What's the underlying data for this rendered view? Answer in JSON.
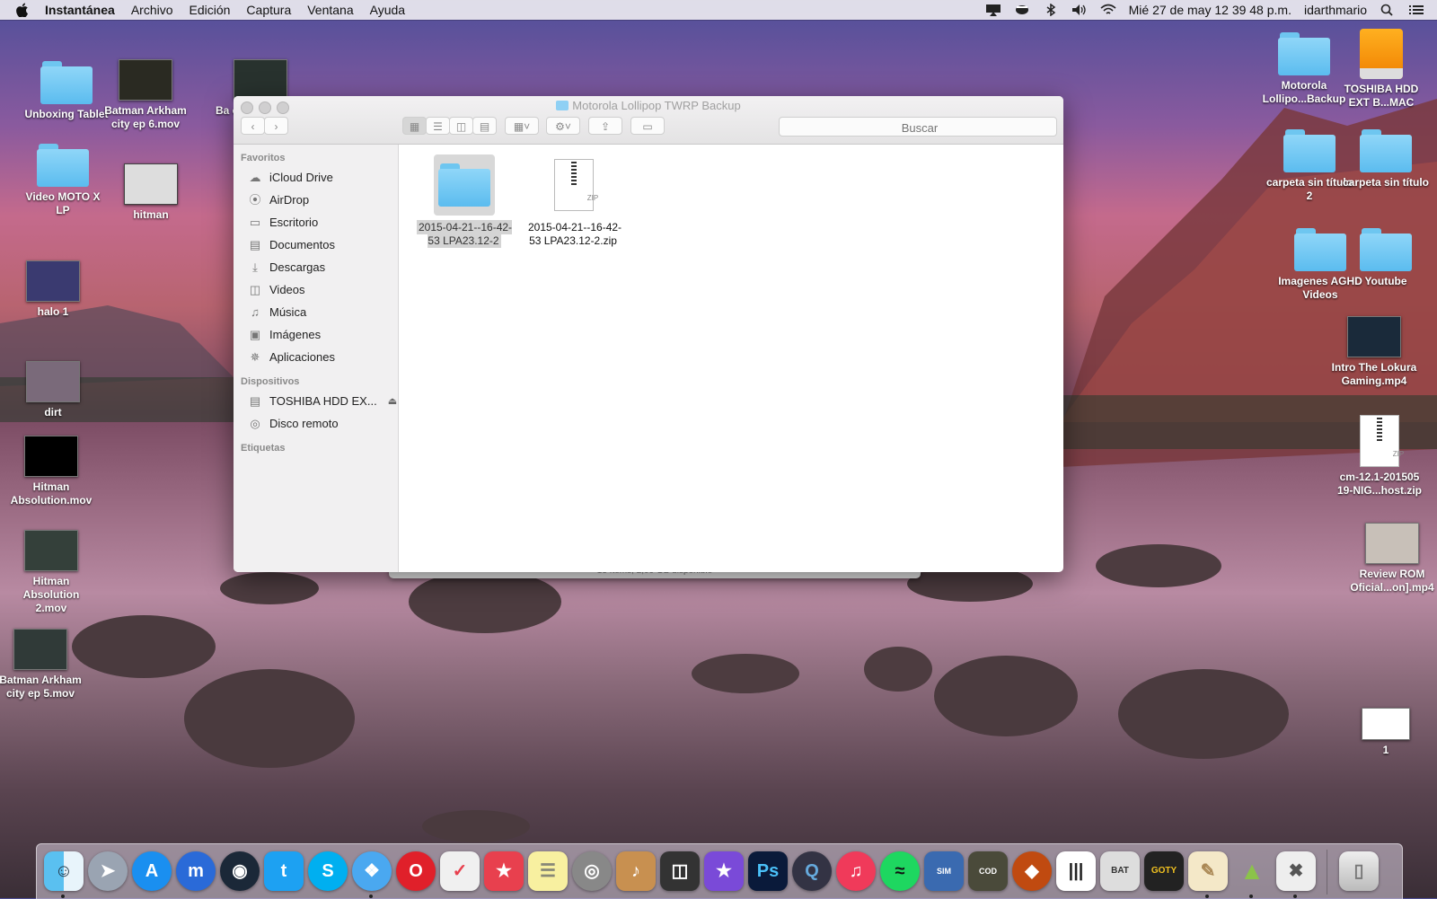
{
  "menubar": {
    "app_name": "Instantánea",
    "menus": [
      "Archivo",
      "Edición",
      "Captura",
      "Ventana",
      "Ayuda"
    ],
    "clock": "Mié 27 de may  12 39 48 p.m.",
    "user": "idarthmario",
    "status_icons": [
      "airplay-icon",
      "coffee-icon",
      "bluetooth-icon",
      "volume-icon",
      "wifi-icon",
      "spotlight-search-icon",
      "notification-list-icon"
    ]
  },
  "desktop_left": [
    {
      "label": "Unboxing Tablet",
      "type": "folder"
    },
    {
      "label": "Batman Arkham city ep 6.mov",
      "type": "video"
    },
    {
      "label": "Ba c",
      "type": "video"
    },
    {
      "label": "Video MOTO X LP",
      "type": "folder"
    },
    {
      "label": "hitman",
      "type": "video"
    },
    {
      "label": "halo 1",
      "type": "video"
    },
    {
      "label": "dirt",
      "type": "video"
    },
    {
      "label": "Hitman Absolution.mov",
      "type": "video"
    },
    {
      "label": "Hitman Absolution 2.mov",
      "type": "video"
    },
    {
      "label": "Batman Arkham city ep 5.mov",
      "type": "video"
    }
  ],
  "desktop_right": [
    {
      "label": "Motorola Lollipo...Backup",
      "type": "folder"
    },
    {
      "label": "TOSHIBA HDD EXT B...MAC",
      "type": "drive"
    },
    {
      "label": "carpeta sin título 2",
      "type": "folder"
    },
    {
      "label": "carpeta sin título",
      "type": "folder"
    },
    {
      "label": "Imagenes AGHD Videos",
      "type": "folder"
    },
    {
      "label": "Youtube",
      "type": "folder"
    },
    {
      "label": "Intro The Lokura Gaming.mp4",
      "type": "video"
    },
    {
      "label": "cm-12.1-201505 19-NIG...host.zip",
      "type": "zip"
    },
    {
      "label": "Review ROM Oficial...on].mp4",
      "type": "video"
    },
    {
      "label": "1",
      "type": "image"
    }
  ],
  "finder": {
    "title": "Motorola Lollipop TWRP Backup",
    "search_placeholder": "Buscar",
    "sidebar": {
      "favorites_header": "Favoritos",
      "favorites": [
        {
          "label": "iCloud Drive",
          "icon": "cloud-icon"
        },
        {
          "label": "AirDrop",
          "icon": "airdrop-icon"
        },
        {
          "label": "Escritorio",
          "icon": "desktop-icon"
        },
        {
          "label": "Documentos",
          "icon": "document-icon"
        },
        {
          "label": "Descargas",
          "icon": "download-icon"
        },
        {
          "label": "Videos",
          "icon": "film-icon"
        },
        {
          "label": "Música",
          "icon": "music-note-icon"
        },
        {
          "label": "Imágenes",
          "icon": "camera-icon"
        },
        {
          "label": "Aplicaciones",
          "icon": "applications-icon"
        }
      ],
      "devices_header": "Dispositivos",
      "devices": [
        {
          "label": "TOSHIBA HDD EX...",
          "icon": "disk-icon",
          "eject": true
        },
        {
          "label": "Disco remoto",
          "icon": "remote-disc-icon"
        }
      ],
      "tags_header": "Etiquetas"
    },
    "files": [
      {
        "name": "2015-04-21--16-42-53 LPA23.12-2",
        "type": "folder",
        "selected": true
      },
      {
        "name": "2015-04-21--16-42-53 LPA23.12-2.zip",
        "type": "zip",
        "selected": false
      }
    ]
  },
  "behind_status": "13 ítems, 2,09 GB disponible",
  "dock": [
    "finder-icon",
    "launchpad-icon",
    "app-store-icon",
    "maxthon-icon",
    "steam-icon",
    "twitter-icon",
    "skype-icon",
    "safari-icon",
    "opera-icon",
    "pocket-icon",
    "bookmark-icon",
    "notes-icon",
    "disk-utility-icon",
    "garageband-icon",
    "final-cut-icon",
    "imovie-icon",
    "photoshop-icon",
    "quicktime-icon",
    "itunes-icon",
    "spotify-icon",
    "simcity-icon",
    "call-of-duty-icon",
    "game-icon",
    "barcode-icon",
    "batman-arkham-icon",
    "batman-goty-icon",
    "textedit-icon",
    "android-icon",
    "utility-icon",
    "trash-icon"
  ],
  "colors": {
    "folder": "#5bbcef",
    "selection": "#d4d4d4"
  }
}
